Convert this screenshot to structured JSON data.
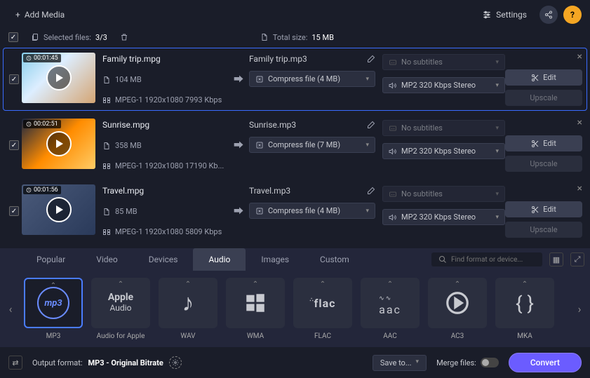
{
  "topbar": {
    "add_media": "Add Media",
    "settings": "Settings"
  },
  "infobar": {
    "selected_label": "Selected files:",
    "selected_value": "3/3",
    "total_label": "Total size:",
    "total_value": "15 MB"
  },
  "files": [
    {
      "selected": true,
      "duration": "00:01:45",
      "source_name": "Family trip.mpg",
      "file_size": "104 MB",
      "format_info": "MPEG-1 1920x1080 7993 Kbps",
      "output_name": "Family trip.mp3",
      "compress": "Compress file (4 MB)",
      "subtitles": "No subtitles",
      "audio": "MP2 320 Kbps Stereo",
      "edit_label": "Edit",
      "upscale_label": "Upscale"
    },
    {
      "selected": false,
      "duration": "00:02:51",
      "source_name": "Sunrise.mpg",
      "file_size": "358 MB",
      "format_info": "MPEG-1 1920x1080 17190 Kb...",
      "output_name": "Sunrise.mp3",
      "compress": "Compress file (7 MB)",
      "subtitles": "No subtitles",
      "audio": "MP2 320 Kbps Stereo",
      "edit_label": "Edit",
      "upscale_label": "Upscale"
    },
    {
      "selected": false,
      "duration": "00:01:56",
      "source_name": "Travel.mpg",
      "file_size": "85 MB",
      "format_info": "MPEG-1 1920x1080 5809 Kbps",
      "output_name": "Travel.mp3",
      "compress": "Compress file (4 MB)",
      "subtitles": "No subtitles",
      "audio": "MP2 320 Kbps Stereo",
      "edit_label": "Edit",
      "upscale_label": "Upscale"
    }
  ],
  "tabs": [
    "Popular",
    "Video",
    "Devices",
    "Audio",
    "Images",
    "Custom"
  ],
  "active_tab": 3,
  "search_placeholder": "Find format or device...",
  "formats": [
    {
      "label": "MP3",
      "icon": "mp3",
      "selected": true
    },
    {
      "label": "Audio for Apple",
      "icon": "apple",
      "selected": false
    },
    {
      "label": "WAV",
      "icon": "note",
      "selected": false
    },
    {
      "label": "WMA",
      "icon": "windows",
      "selected": false
    },
    {
      "label": "FLAC",
      "icon": "flac",
      "selected": false
    },
    {
      "label": "AAC",
      "icon": "aac",
      "selected": false
    },
    {
      "label": "AC3",
      "icon": "ac3",
      "selected": false
    },
    {
      "label": "MKA",
      "icon": "mka",
      "selected": false
    }
  ],
  "bottom": {
    "output_label": "Output format:",
    "output_value": "MP3 - Original Bitrate",
    "save_to": "Save to...",
    "merge_label": "Merge files:",
    "convert": "Convert"
  }
}
